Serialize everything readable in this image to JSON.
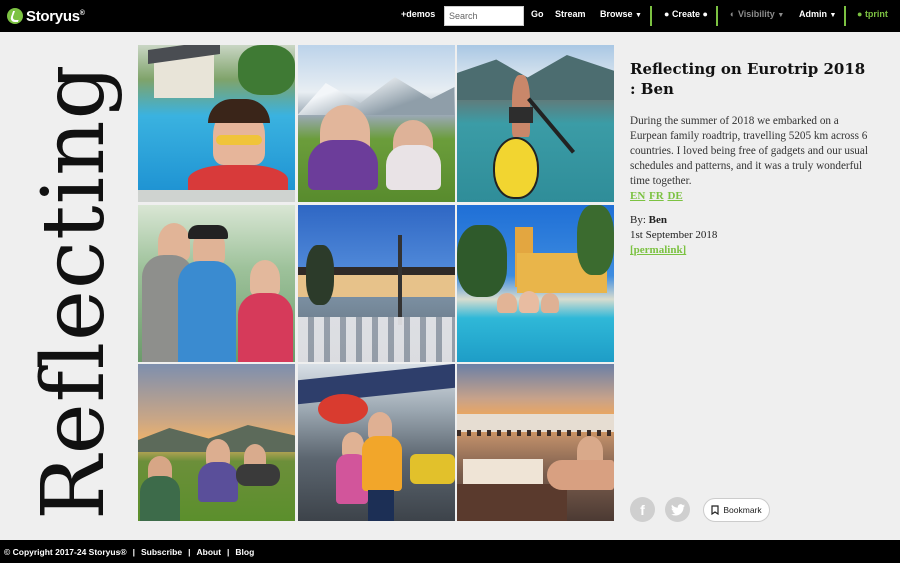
{
  "nav": {
    "brand": "Storyus",
    "trademark": "®",
    "demos": "+demos",
    "search_placeholder": "Search",
    "go": "Go",
    "stream": "Stream",
    "browse": "Browse",
    "create": "Create",
    "visibility": "Visibility",
    "admin": "Admin",
    "tprint": "tprint",
    "accent_color": "#7cc242"
  },
  "story": {
    "vertical_title": "Reflecting",
    "title": "Reflecting on Eurotrip 2018 : Ben",
    "description": "During the summer of 2018 we embarked on a Eurpean family roadtrip, travelling 5205 km across 6 countries. I loved being free of gadgets and our usual schedules and patterns, and it was a truly wonderful time together.",
    "languages": [
      "EN",
      "FR",
      "DE"
    ],
    "by_label": "By:",
    "author": "Ben",
    "date": "1st September 2018",
    "permalink": "[permalink]"
  },
  "photos": [
    {
      "subject": "girl with goggles in swimming pool"
    },
    {
      "subject": "boys sitting in alpine meadow"
    },
    {
      "subject": "paddleboarder on turquoise lake"
    },
    {
      "subject": "family portrait outdoors"
    },
    {
      "subject": "lakeside restaurant at dusk"
    },
    {
      "subject": "family in pool by yellow villa"
    },
    {
      "subject": "family on hillside at sunset"
    },
    {
      "subject": "kids at airplane museum"
    },
    {
      "subject": "relaxing on terrace at sunset"
    }
  ],
  "share": {
    "facebook": "f",
    "twitter_icon": "bird-icon",
    "bookmark": "Bookmark"
  },
  "footer": {
    "copyright": "© Copyright 2017-24 Storyus®",
    "subscribe": "Subscribe",
    "about": "About",
    "blog": "Blog"
  }
}
